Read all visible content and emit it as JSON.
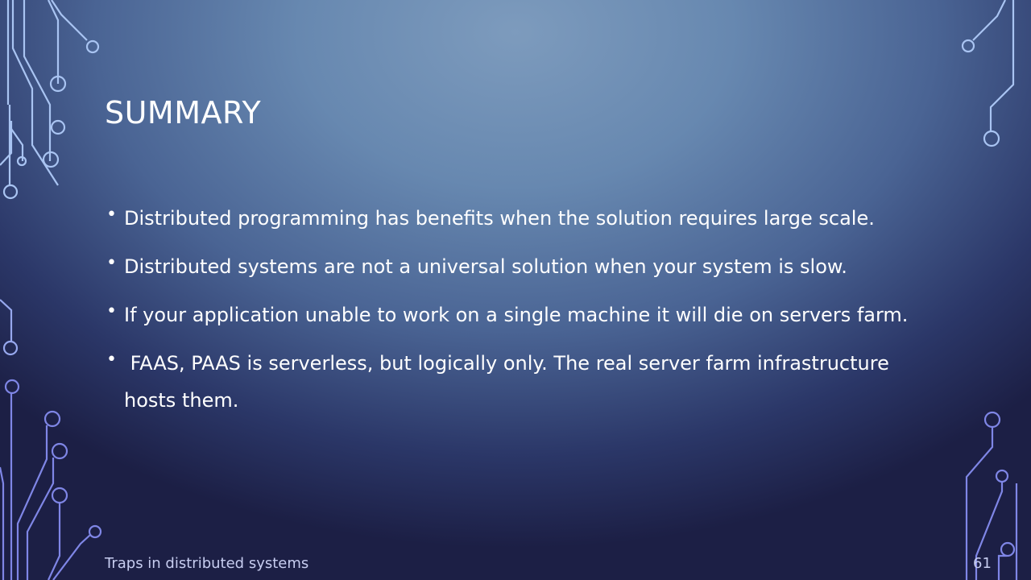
{
  "slide": {
    "title": "SUMMARY",
    "bullets": [
      "Distributed programming has benefits when the solution requires large scale.",
      "Distributed systems are not a universal solution when your system is slow.",
      "If your application unable to work on a single machine it will die on servers farm.",
      " FAAS, PAAS is serverless, but logically only. The real server farm infrastructure hosts them."
    ],
    "bullet_glyph": "•",
    "footer": "Traps in distributed systems",
    "page_number": "61"
  },
  "colors": {
    "title": "#ffffff",
    "body_text": "#ffffff",
    "footer_text": "#c7cdf0",
    "circuit_light": "#a9c4f2",
    "circuit_dark": "#7f86e6"
  },
  "icons": [
    "circuit-trace-decoration-left",
    "circuit-trace-decoration-right"
  ]
}
